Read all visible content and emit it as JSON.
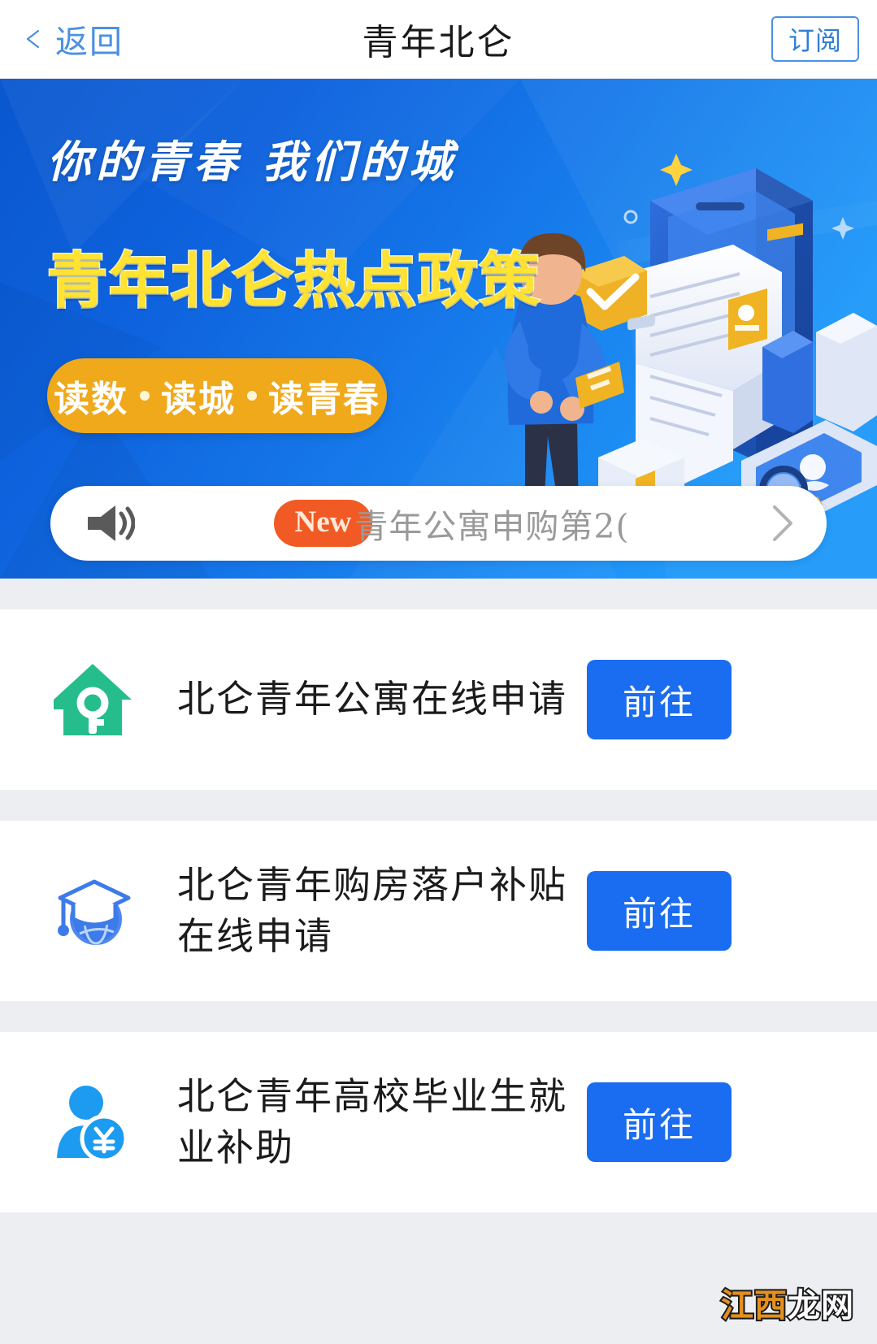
{
  "header": {
    "back_label": "返回",
    "title": "青年北仑",
    "subscribe_label": "订阅",
    "back_icon": "chevron-left-icon",
    "accent_color": "#4a90e2"
  },
  "banner": {
    "tagline": "你的青春  我们的城",
    "headline": "青年北仑热点政策",
    "pill_parts": [
      "读数",
      "读城",
      "读青春"
    ],
    "pill_text": "读数 • 读城 • 读青春",
    "bg_color_start": "#0a57cf",
    "bg_color_end": "#1f94f7",
    "headline_color": "#ffe232",
    "pill_color": "#efa91b",
    "illustration": "isometric-person-phone-document-illustration"
  },
  "notice": {
    "speaker_icon": "speaker-icon",
    "badge_label": "New",
    "badge_color": "#f15a24",
    "text": "青年公寓申购第2(",
    "arrow_icon": "chevron-right-icon"
  },
  "list": {
    "items": [
      {
        "icon": "house-key-icon",
        "icon_color": "#26bd8c",
        "title": "北仑青年公寓在线申请",
        "action_label": "前往"
      },
      {
        "icon": "graduation-cap-globe-icon",
        "icon_color": "#3d7bea",
        "title": "北仑青年购房落户补贴在线申请",
        "action_label": "前往"
      },
      {
        "icon": "person-yuan-icon",
        "icon_color": "#1c9bf0",
        "title": "北仑青年高校毕业生就业补助",
        "action_label": "前往"
      }
    ],
    "action_button_color": "#1a6cf0"
  },
  "watermark": {
    "orange_part": "江西",
    "white_part": "龙网"
  }
}
